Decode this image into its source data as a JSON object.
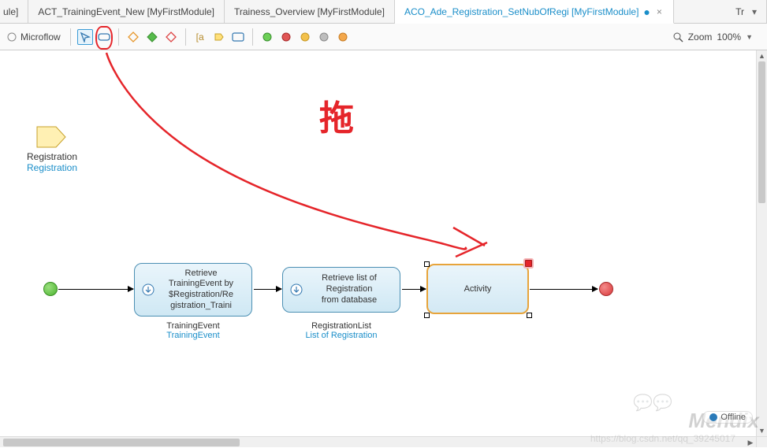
{
  "tabs": {
    "partial_left": "ule]",
    "t1": "ACT_TrainingEvent_New [MyFirstModule]",
    "t2": "Trainess_Overview [MyFirstModule]",
    "t3": "ACO_Ade_Registration_SetNubOfRegi [MyFirstModule]",
    "t3_modified": "●",
    "t3_close": "×",
    "partial_right": "Tr"
  },
  "toolbar": {
    "microflow_label": "Microflow",
    "zoom_label": "Zoom",
    "zoom_value": "100%"
  },
  "parameter": {
    "name": "Registration",
    "type": "Registration"
  },
  "activity1": {
    "lines": [
      "Retrieve",
      "TrainingEvent by",
      "$Registration/Re",
      "gistration_Traini"
    ],
    "label1": "TrainingEvent",
    "label2": "TrainingEvent"
  },
  "activity2": {
    "lines": [
      "Retrieve list of",
      "Registration",
      "from database"
    ],
    "label1": "RegistrationList",
    "label2": "List of Registration"
  },
  "activity3": {
    "label": "Activity"
  },
  "annotation": {
    "text": "拖"
  },
  "watermark": {
    "text": "Mendix",
    "url": "https://blog.csdn.net/qq_39245017",
    "status": "Offline"
  }
}
